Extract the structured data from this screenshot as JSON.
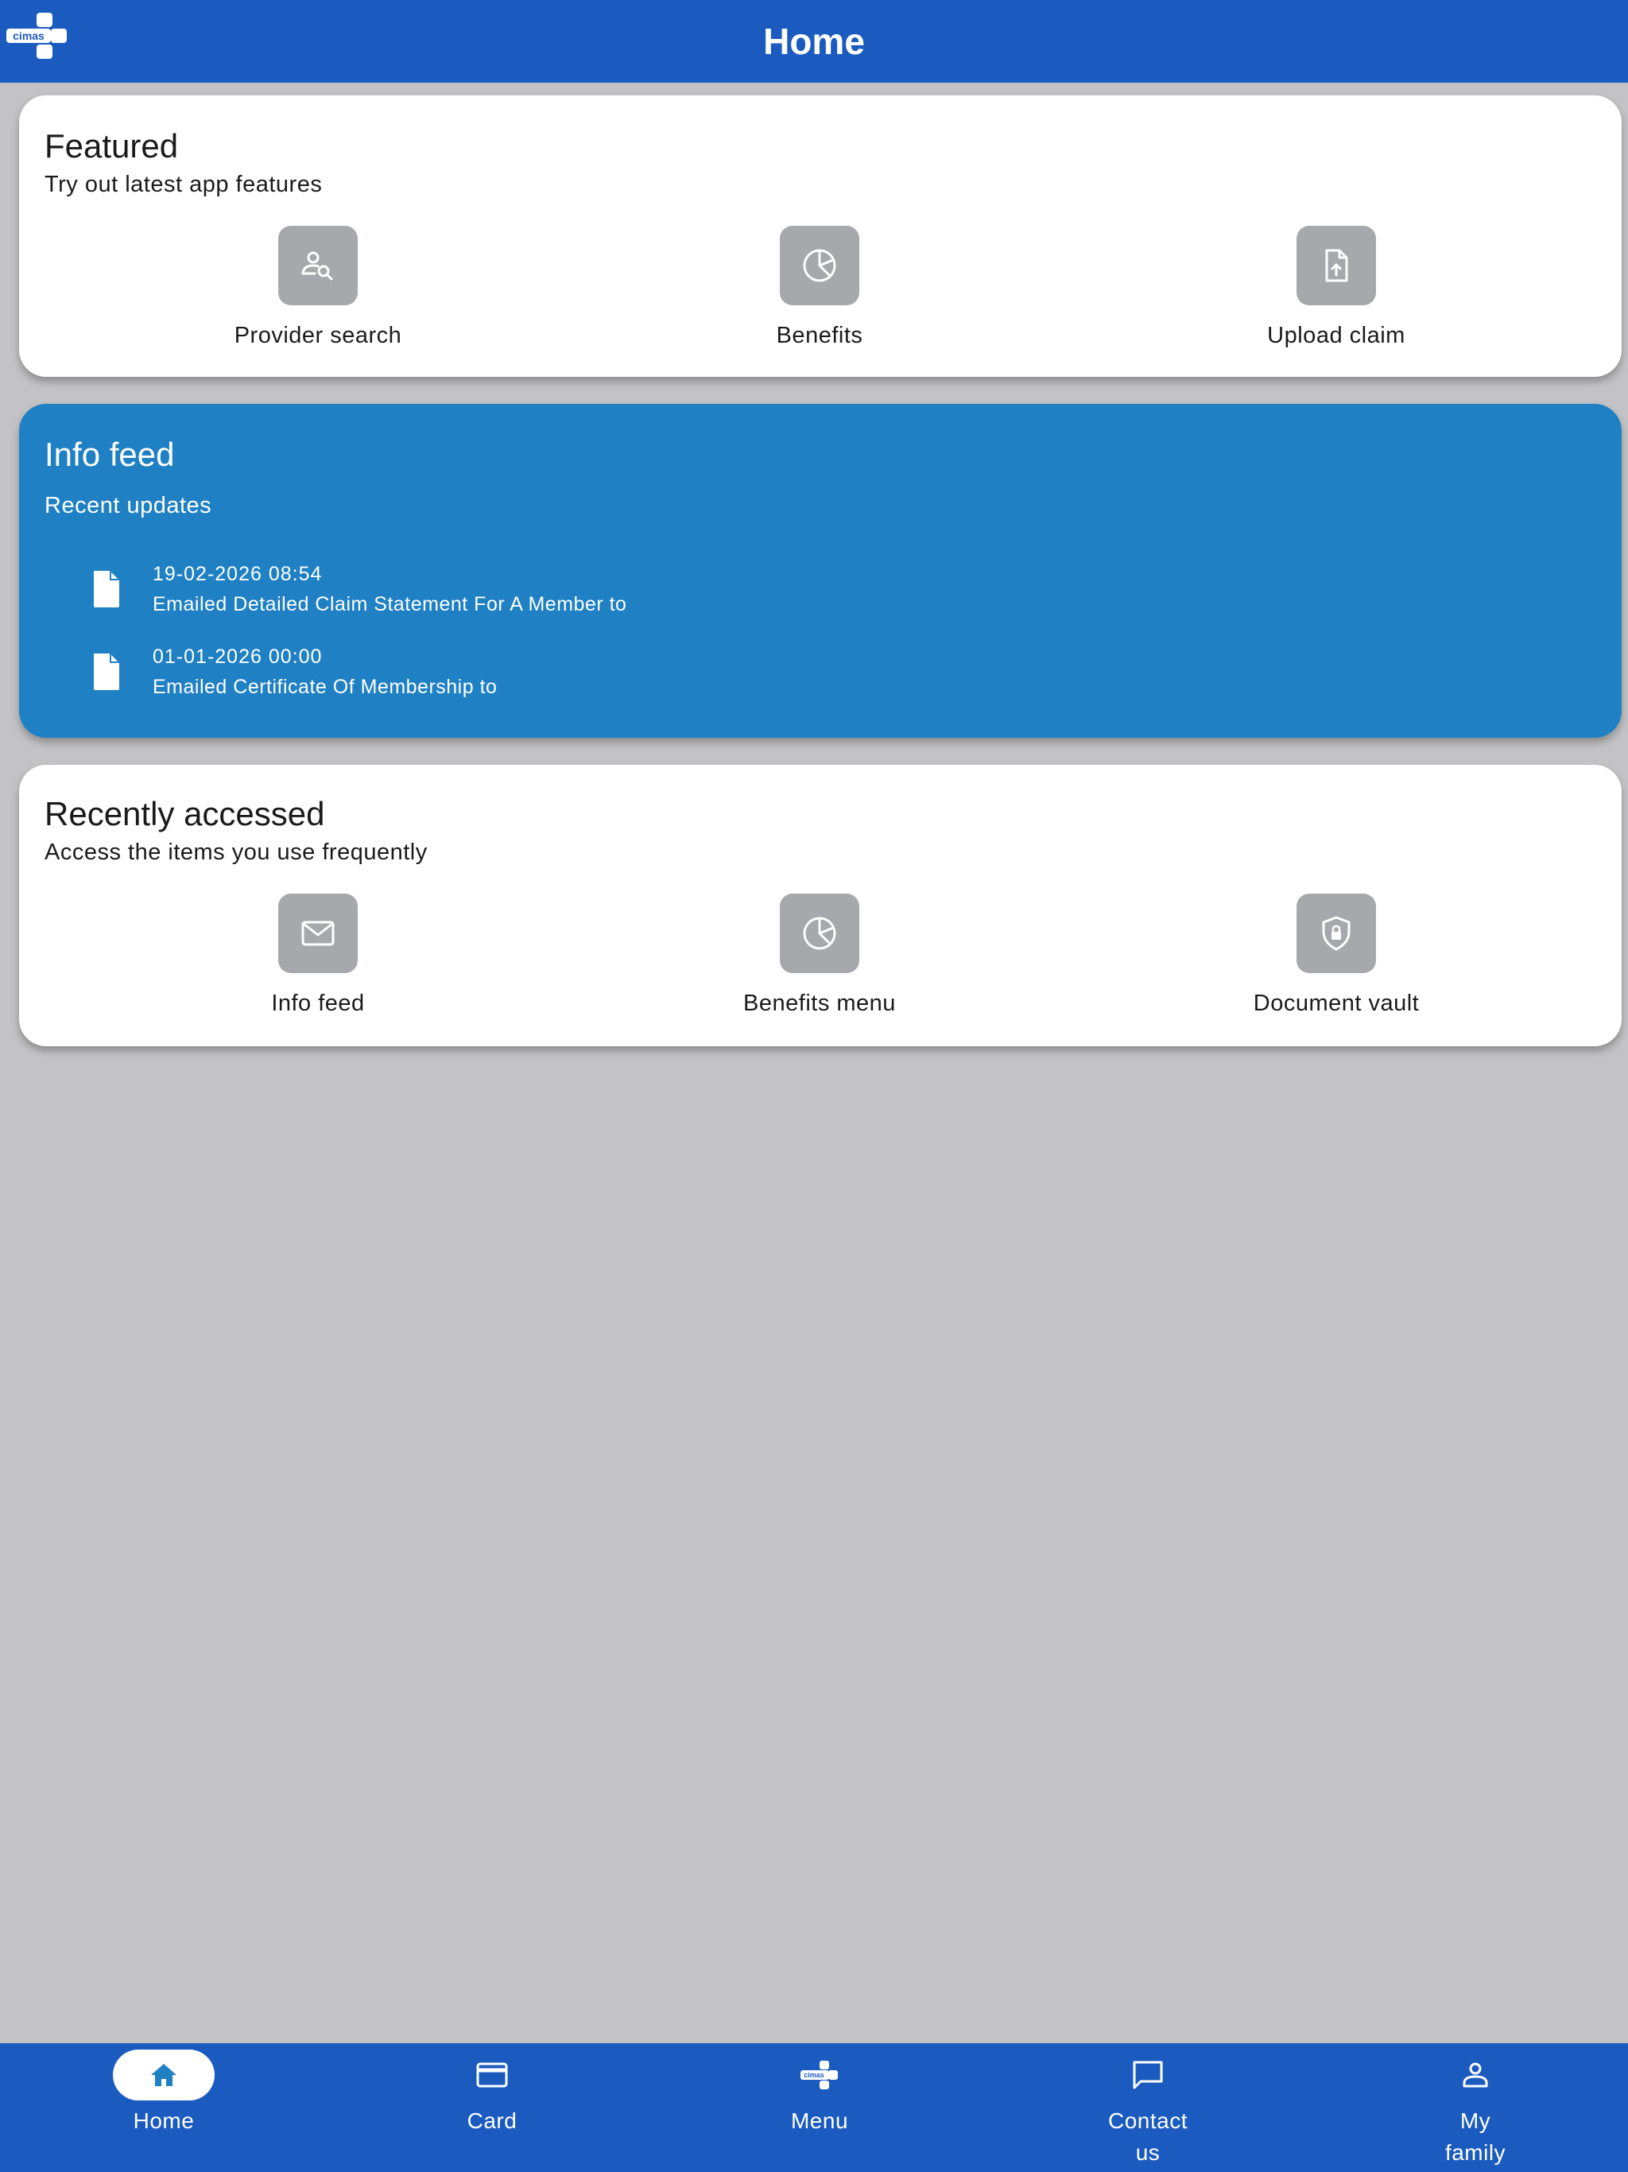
{
  "header": {
    "title": "Home",
    "logo_text": "cimas"
  },
  "featured": {
    "title": "Featured",
    "subtitle": "Try out latest app features",
    "tiles": [
      {
        "label": "Provider search",
        "icon": "provider-search-icon"
      },
      {
        "label": "Benefits",
        "icon": "pie-chart-icon"
      },
      {
        "label": "Upload claim",
        "icon": "upload-file-icon"
      }
    ]
  },
  "info_feed": {
    "title": "Info feed",
    "subtitle": "Recent updates",
    "items": [
      {
        "date": "19-02-2026 08:54",
        "text": "Emailed Detailed Claim Statement For A Member to",
        "icon": "document-icon"
      },
      {
        "date": "01-01-2026 00:00",
        "text": "Emailed Certificate Of Membership to",
        "icon": "document-icon"
      }
    ]
  },
  "recent": {
    "title": "Recently accessed",
    "subtitle": "Access the items you use frequently",
    "tiles": [
      {
        "label": "Info feed",
        "icon": "mail-icon"
      },
      {
        "label": "Benefits menu",
        "icon": "pie-chart-icon"
      },
      {
        "label": "Document vault",
        "icon": "shield-lock-icon"
      }
    ]
  },
  "bottom_nav": {
    "items": [
      {
        "label": "Home",
        "icon": "home-icon",
        "active": true
      },
      {
        "label": "Card",
        "icon": "credit-card-icon"
      },
      {
        "label": "Menu",
        "icon": "cimas-logo-icon"
      },
      {
        "label": "Contact\nus",
        "icon": "chat-bubble-icon"
      },
      {
        "label": "My\nfamily",
        "icon": "person-icon"
      }
    ]
  },
  "colors": {
    "primary_bar": "#1b5bbf",
    "info_feed_card": "#1f80c4",
    "background": "#c3c3c5",
    "tile_icon_bg": "#a6a8ab"
  }
}
